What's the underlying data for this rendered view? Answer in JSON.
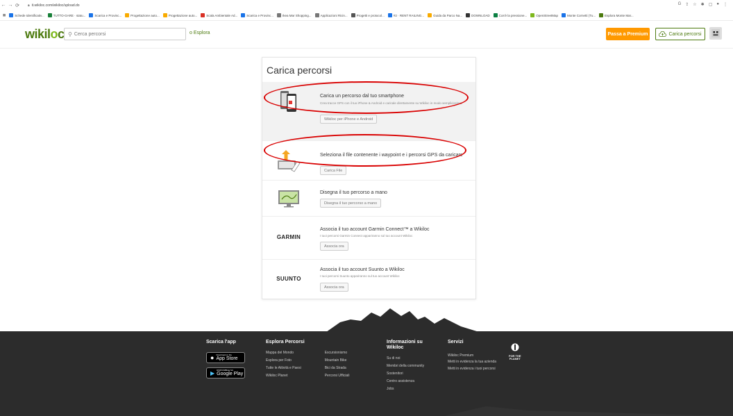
{
  "browser": {
    "url": "it.wikiloc.com/wikiloc/upload.do",
    "bookmarks": [
      {
        "label": "Schede Identificativ...",
        "color": "#1a73e8"
      },
      {
        "label": "TUTTO-GARE · statu...",
        "color": "#188038"
      },
      {
        "label": "Scarica e Provinc...",
        "color": "#1a73e8"
      },
      {
        "label": "Progettazione auto...",
        "color": "#f9ab00"
      },
      {
        "label": "Progettazione auto...",
        "color": "#f9ab00"
      },
      {
        "label": "Scala Ambientale Ad...",
        "color": "#d93025"
      },
      {
        "label": "Scarica e Provinc...",
        "color": "#1a73e8"
      },
      {
        "label": "Ikea Mar Shopping...",
        "color": "#777777"
      },
      {
        "label": "Applicazioni Ricin...",
        "color": "#777777"
      },
      {
        "label": "Progetti e protocol...",
        "color": "#555555"
      },
      {
        "label": "#2 · RENT RAILING...",
        "color": "#1a73e8"
      },
      {
        "label": "Guida da Parco Na...",
        "color": "#f9ab00"
      },
      {
        "label": "DOWNLOAD",
        "color": "#333333"
      },
      {
        "label": "Cos'è la pressione...",
        "color": "#0b8043"
      },
      {
        "label": "OpenStreetMap",
        "color": "#7eb81d"
      },
      {
        "label": "Monte Cornetti (Tu...",
        "color": "#1a73e8"
      },
      {
        "label": "Esplora Monte Mar...",
        "color": "#4c7a0e"
      }
    ]
  },
  "header": {
    "logo_main": "wikil",
    "logo_o": "o",
    "logo_end": "c",
    "search_placeholder": "Cerca percorsi",
    "explore_label": "o Esplora",
    "premium_label": "Passa a Premium",
    "upload_label": "Carica percorsi"
  },
  "card": {
    "title": "Carica percorsi",
    "options": [
      {
        "title": "Carica un percorso dal tuo smartphone",
        "desc": "Crea tracce GPS con il tuo iPhone & Android e caricale direttamente su Wikiloc in modo semplicissimo.",
        "button": "Wikiloc per iPhone e Android"
      },
      {
        "title": "Seleziona il file contenente i waypoint e i percorsi GPS da caricare",
        "desc": "",
        "button": "Carica File"
      },
      {
        "title": "Disegna il tuo percorso a mano",
        "desc": "",
        "button": "Disegna il tuo percorso a mano"
      },
      {
        "brand": "GARMIN",
        "title": "Associa il tuo account Garmin Connect™ a Wikiloc",
        "desc": "I tuoi percorsi Garmin Connect appariranno sul tuo account Wikiloc",
        "button": "Associa ora"
      },
      {
        "brand": "SUUNTO",
        "title": "Associa il tuo account Suunto a Wikiloc",
        "desc": "I tuoi percorsi Suunto appariranno sul tuo account Wikiloc",
        "button": "Associa ora"
      }
    ]
  },
  "footer": {
    "app": {
      "heading": "Scarica l'app",
      "appstore_small": "Download on the",
      "appstore_big": "App Store",
      "play_small": "DISPONIBILE SU",
      "play_big": "Google Play"
    },
    "explore": {
      "heading": "Esplora Percorsi",
      "col1": [
        "Mappa del Mondo",
        "Esplora per Foto",
        "Tutte le Attività e Paesi",
        "Wikiloc Planet"
      ],
      "col2": [
        "Escursionismo",
        "Mountain Bike",
        "Bici da Strada",
        "Percorsi Ufficiali"
      ]
    },
    "info": {
      "heading_line1": "Informazioni su",
      "heading_line2": "Wikiloc",
      "links": [
        "Su di noi",
        "Membri della community",
        "Sostenitori",
        "Centro assistenza",
        "Jobs"
      ]
    },
    "services": {
      "heading": "Servizi",
      "links": [
        "Wikiloc Premium",
        "Metti in evidenza la tua azienda",
        "Metti in evidenza i tuoi percorsi"
      ]
    },
    "planet": {
      "line1": "FOR THE",
      "line2": "PLANET"
    }
  }
}
